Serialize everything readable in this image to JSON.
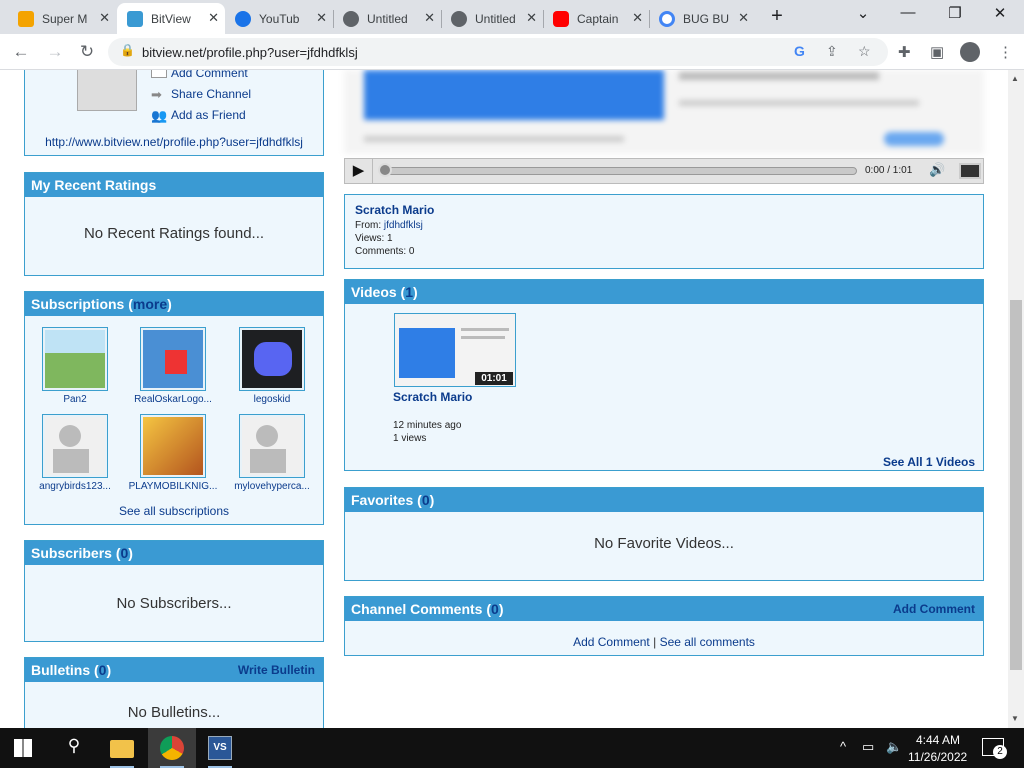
{
  "tabs": [
    {
      "title": "Super M",
      "favicon_color": "#f4a300"
    },
    {
      "title": "BitView",
      "favicon_color": "#3a9ad3"
    },
    {
      "title": "YouTub",
      "favicon_color": "#1a73e8"
    },
    {
      "title": "Untitled",
      "favicon_color": "#5f6368"
    },
    {
      "title": "Untitled",
      "favicon_color": "#5f6368"
    },
    {
      "title": "Captain",
      "favicon_color": "#ff0000"
    },
    {
      "title": "BUG BU",
      "favicon_color": "#4285f4"
    }
  ],
  "address_bar": {
    "url": "bitview.net/profile.php?user=jfdhdfklsj"
  },
  "profile_actions": {
    "add_comment": "Add Comment",
    "share_channel": "Share Channel",
    "add_friend": "Add as Friend",
    "profile_url": "http://www.bitview.net/profile.php?user=jfdhdfklsj"
  },
  "recent_ratings": {
    "title": "My Recent Ratings",
    "empty": "No Recent Ratings found..."
  },
  "subscriptions": {
    "title": "Subscriptions (",
    "more": "more",
    "close": ")",
    "see_all": "See all subscriptions",
    "items": [
      {
        "name": "Pan2",
        "color": "#7fb75e"
      },
      {
        "name": "RealOskarLogo...",
        "color": "#4a8fd4"
      },
      {
        "name": "legoskid",
        "color": "#5865f2"
      },
      {
        "name": "angrybirds123...",
        "color": "#d8d8d8"
      },
      {
        "name": "PLAYMOBILKNIG...",
        "color": "#d89a2a"
      },
      {
        "name": "mylovehyperca...",
        "color": "#d8d8d8"
      }
    ]
  },
  "subscribers": {
    "title": "Subscribers (",
    "count": "0",
    "close": ")",
    "empty": "No Subscribers..."
  },
  "bulletins": {
    "title": "Bulletins (",
    "count": "0",
    "close": ")",
    "write": "Write Bulletin",
    "empty": "No Bulletins..."
  },
  "player": {
    "time": "0:00 / 1:01"
  },
  "video_info": {
    "title": "Scratch Mario",
    "from_label": "From: ",
    "from_user": "jfdhdfklsj",
    "views": "Views: 1",
    "comments": "Comments: 0"
  },
  "videos": {
    "title": "Videos (",
    "count": "1",
    "close": ")",
    "item": {
      "title": "Scratch Mario",
      "duration": "01:01",
      "age": "12 minutes ago",
      "views": "1 views"
    },
    "see_all": "See All 1 Videos"
  },
  "favorites": {
    "title": "Favorites (",
    "count": "0",
    "close": ")",
    "empty": "No Favorite Videos..."
  },
  "channel_comments": {
    "title": "Channel Comments (",
    "count": "0",
    "close": ")",
    "add": "Add Comment",
    "add_link": "Add Comment",
    "sep": " | ",
    "see_all": "See all comments"
  },
  "taskbar": {
    "time": "4:44 AM",
    "date": "11/26/2022",
    "notifications": "2"
  }
}
